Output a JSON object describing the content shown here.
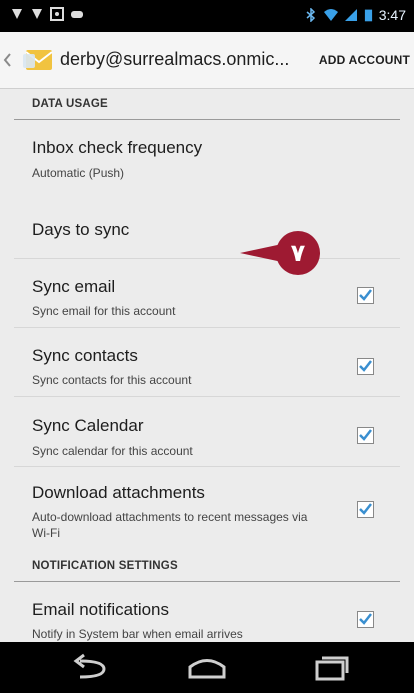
{
  "status_bar": {
    "time": "3:47"
  },
  "action_bar": {
    "account": "derby@surrealmacs.onmic...",
    "add_account": "ADD ACCOUNT"
  },
  "sections": {
    "data_usage": "DATA USAGE",
    "notification_settings": "NOTIFICATION SETTINGS"
  },
  "rows": {
    "inbox": {
      "title": "Inbox check frequency",
      "summary": "Automatic (Push)"
    },
    "days": {
      "title": "Days to sync"
    },
    "sync_email": {
      "title": "Sync email",
      "summary": "Sync email for this account",
      "checked": true
    },
    "sync_contacts": {
      "title": "Sync contacts",
      "summary": "Sync contacts for this account",
      "checked": true
    },
    "sync_calendar": {
      "title": "Sync Calendar",
      "summary": "Sync calendar for this account",
      "checked": true
    },
    "download": {
      "title": "Download attachments",
      "summary": "Auto-download attachments to recent messages via Wi-Fi",
      "checked": true
    },
    "email_notifications": {
      "title": "Email notifications",
      "summary": "Notify in System bar when email arrives",
      "checked": true
    }
  },
  "annotation": {
    "number": "٧",
    "color": "#9e1a32"
  },
  "colors": {
    "checkbox": "#3a8fd0",
    "status_icons": "#39a0e8"
  }
}
